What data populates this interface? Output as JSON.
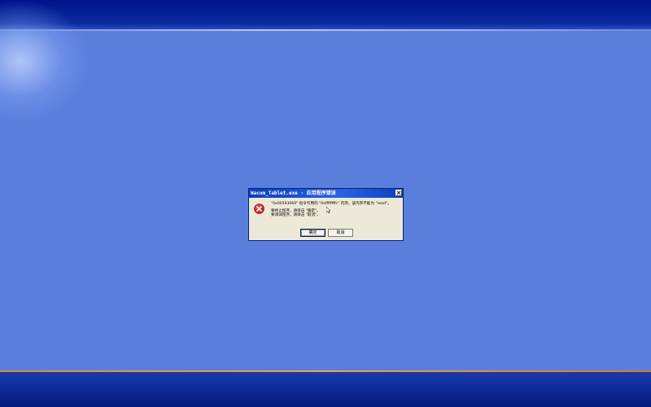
{
  "dialog": {
    "title": "Wacom_Tablet.exe - 应用程序错误",
    "close_label": "×",
    "message_lines": [
      "\"0x00593066\" 指令引用的 \"0xffffffffc\" 内存。该内存不能为 \"read\"。",
      "",
      "要终止程序，请单击 \"确定\"。",
      "要调试程序，请单击 \"取消\"。"
    ],
    "ok_label": "确定",
    "cancel_label": "取消",
    "icon": "error-icon"
  },
  "colors": {
    "desktop": "#5a7edc",
    "titlebar": "#2a62e6",
    "dialog_bg": "#ece9d8",
    "error_red": "#d81e1e"
  }
}
